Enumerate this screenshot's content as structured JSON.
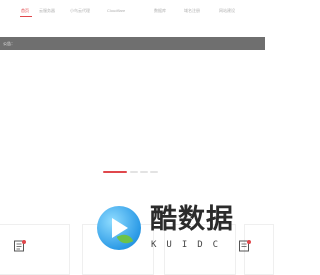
{
  "nav": {
    "items": [
      {
        "label": "首页",
        "active": true
      },
      {
        "label": "云服务器",
        "active": false
      },
      {
        "label": "小鸟云代理",
        "active": false
      },
      {
        "label": "Cloudflare",
        "active": false
      },
      {
        "label": "数据库",
        "active": false
      },
      {
        "label": "域名注册",
        "active": false
      },
      {
        "label": "网站建设",
        "active": false
      }
    ]
  },
  "notice": {
    "text": "公告："
  },
  "carousel": {
    "slide_count": 4,
    "active_index": 0
  },
  "watermark": {
    "title": "酷数据",
    "subtitle": "KUIDC"
  },
  "colors": {
    "accent": "#e0474c",
    "notice_bg": "#6f6f6f",
    "nav_text": "#b0b0b0",
    "watermark_blue": "#2b9ae6",
    "watermark_green": "#6cc24a"
  },
  "cards": [
    {
      "icon": "document-icon"
    },
    {
      "icon": "blank"
    },
    {
      "icon": "blank"
    },
    {
      "icon": "doc-badge-icon"
    }
  ]
}
